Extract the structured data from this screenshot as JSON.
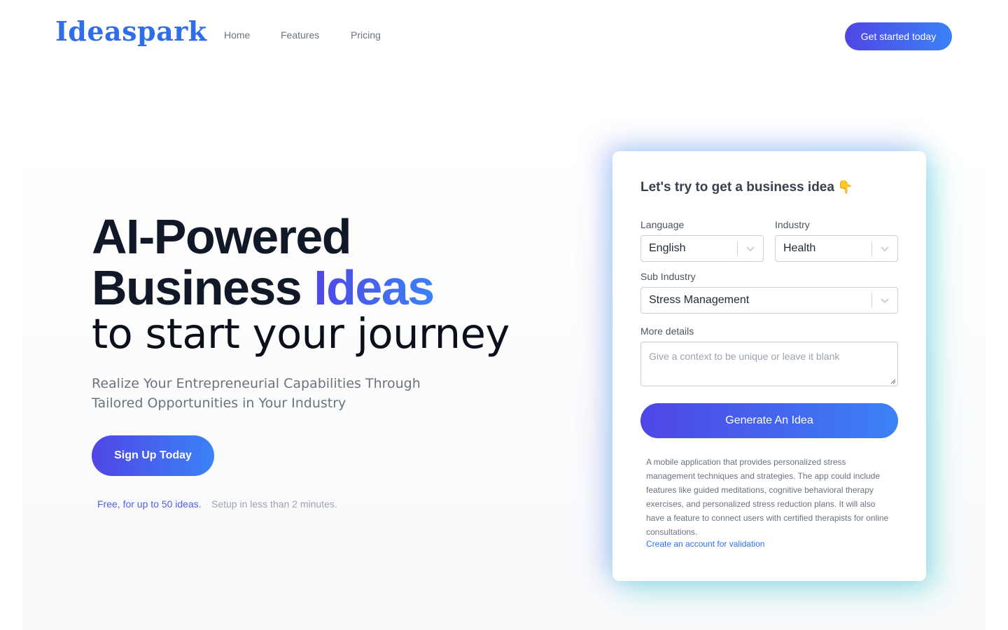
{
  "nav": {
    "logo": "Ideaspark",
    "links": [
      {
        "label": "Home"
      },
      {
        "label": "Features"
      },
      {
        "label": "Pricing"
      }
    ],
    "cta_label": "Get started today"
  },
  "hero": {
    "title_line1": "AI-Powered",
    "title_line2_plain": "Business",
    "title_line2_accent": "Ideas",
    "title_line3": "to start your journey",
    "subtitle": "Realize Your Entrepreneurial Capabilities Through Tailored Opportunities in Your Industry",
    "signup_label": "Sign Up Today",
    "free_note": "Free, for up to 50 ideas.",
    "setup_note": "Setup in less than 2 minutes."
  },
  "form": {
    "title": "Let's try to get a business idea",
    "title_icon": "pointing-down-icon",
    "language": {
      "label": "Language",
      "value": "English"
    },
    "industry": {
      "label": "Industry",
      "value": "Health"
    },
    "sub_industry": {
      "label": "Sub Industry",
      "value": "Stress Management"
    },
    "details": {
      "label": "More details",
      "placeholder": "Give a context to be unique or leave it blank"
    },
    "generate_label": "Generate An Idea",
    "result_text": "A mobile application that provides personalized stress management techniques and strategies. The app could include features like guided meditations, cognitive behavioral therapy exercises, and personalized stress reduction plans. It will also have a feature to connect users with certified therapists for online consultations.",
    "result_link": "Create an account for validation"
  },
  "colors": {
    "brand_blue": "#2f6ee8",
    "gradient_start": "#4f46e5",
    "gradient_end": "#3b82f6"
  }
}
